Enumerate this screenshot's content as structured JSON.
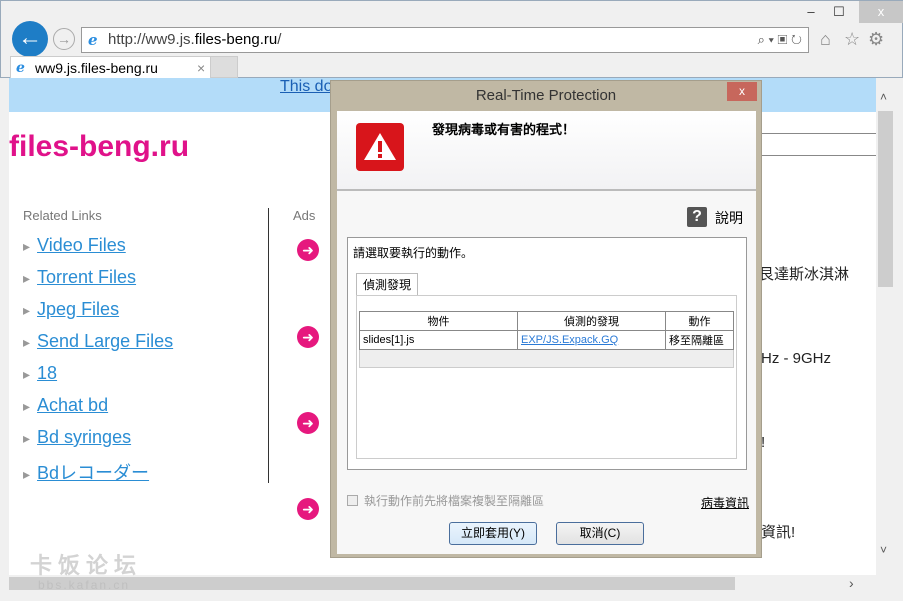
{
  "browser": {
    "url_prefix": "http://ww9.js.",
    "url_domain": "files-beng.ru",
    "url_suffix": "/",
    "tab_title": "ww9.js.files-beng.ru",
    "minimize": "–",
    "maximize": "☐",
    "close": "x"
  },
  "page": {
    "banner_text": "This do",
    "site_title": "files-beng.ru",
    "related_label": "Related Links",
    "ads_label": "Ads",
    "links": [
      "Video Files",
      "Torrent Files",
      "Jpeg Files",
      "Send Large Files",
      "18",
      "Achat bd",
      "Bd syringes",
      "Bdレコーダー"
    ],
    "right_texts": [
      "艮達斯冰淇淋",
      "Hz - 9GHz",
      "!",
      "資訊!"
    ]
  },
  "dialog": {
    "title": "Real-Time Protection",
    "headline": "發現病毒或有害的程式！",
    "help": "說明",
    "prompt": "請選取要執行的動作。",
    "tab": "偵測發現",
    "columns": [
      "物件",
      "偵測的發現",
      "動作"
    ],
    "rows": [
      {
        "object": "slides[1].js",
        "detection": "EXP/JS.Expack.GQ",
        "action": "移至隔離區"
      }
    ],
    "checkbox_label": "執行動作前先將檔案複製至隔離區",
    "checkbox_checked": false,
    "virus_info": "病毒資訊",
    "apply": "立即套用(Y)",
    "cancel": "取消(C)"
  },
  "watermark": {
    "text": "卡饭论坛",
    "sub": "bbs.kafan.cn"
  }
}
